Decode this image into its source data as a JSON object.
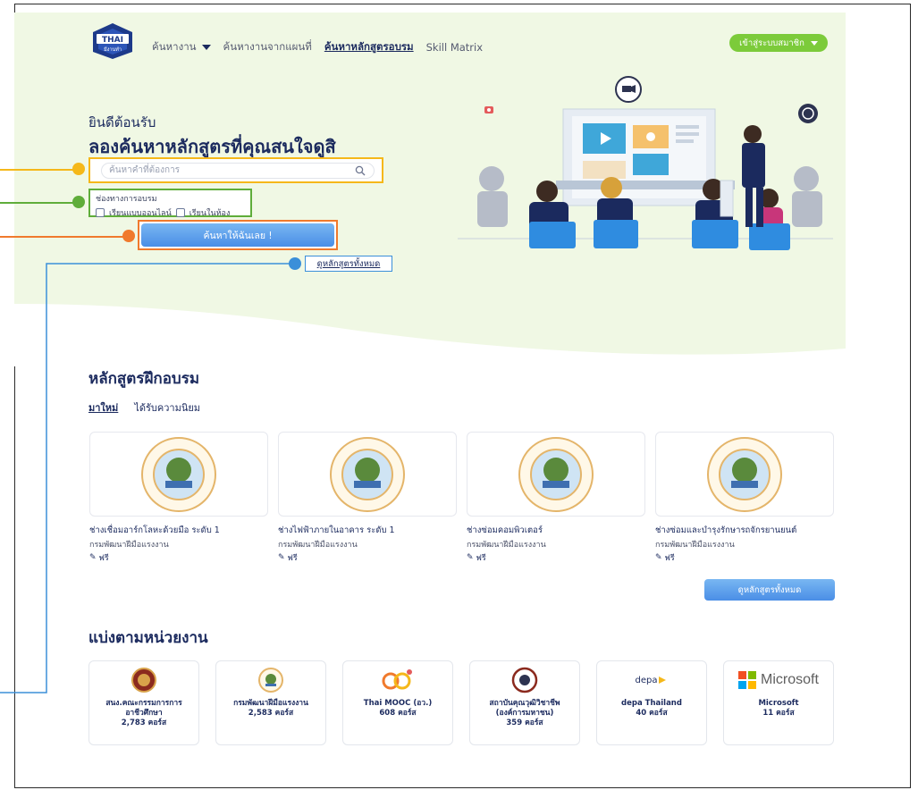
{
  "header": {
    "logo_text": "THAI",
    "logo_sub": "มีงานทำ",
    "nav": [
      {
        "label": "ค้นหางาน",
        "has_caret": true,
        "active": false
      },
      {
        "label": "ค้นหางานจากแผนที่",
        "has_caret": false,
        "active": false
      },
      {
        "label": "ค้นหาหลักสูตรอบรม",
        "has_caret": false,
        "active": true
      },
      {
        "label": "Skill Matrix",
        "has_caret": false,
        "active": false
      }
    ],
    "member_button": "เข้าสู่ระบบสมาชิก"
  },
  "hero": {
    "welcome": "ยินดีต้อนรับ",
    "headline": "ลองค้นหาหลักสูตรที่คุณสนใจดูสิ",
    "search_placeholder": "ค้นหาคำที่ต้องการ",
    "mode_label": "ช่องทางการอบรม",
    "mode_online": "เรียนแบบออนไลน์",
    "mode_classroom": "เรียนในห้อง",
    "search_button": "ค้นหาให้ฉันเลย !",
    "all_courses_link": "ดูหลักสูตรทั้งหมด"
  },
  "courses": {
    "title": "หลักสูตรฝึกอบรม",
    "tabs": [
      "มาใหม่",
      "ได้รับความนิยม"
    ],
    "items": [
      {
        "title": "ช่างเชื่อมอาร์กโลหะด้วยมือ ระดับ 1",
        "org": "กรมพัฒนาฝีมือแรงงาน",
        "price": "ฟรี"
      },
      {
        "title": "ช่างไฟฟ้าภายในอาคาร ระดับ 1",
        "org": "กรมพัฒนาฝีมือแรงงาน",
        "price": "ฟรี"
      },
      {
        "title": "ช่างซ่อมคอมพิวเตอร์",
        "org": "กรมพัฒนาฝีมือแรงงาน",
        "price": "ฟรี"
      },
      {
        "title": "ช่างซ่อมและบำรุงรักษารถจักรยานยนต์",
        "org": "กรมพัฒนาฝีมือแรงงาน",
        "price": "ฟรี"
      }
    ],
    "view_all_button": "ดูหลักสูตรทั้งหมด"
  },
  "agencies": {
    "title": "แบ่งตามหน่วยงาน",
    "items": [
      {
        "name_line1": "สนง.คณะกรรมการการ",
        "name_line2": "อาชีวศึกษา",
        "count": "2,783 คอร์ส"
      },
      {
        "name_line1": "กรมพัฒนาฝีมือแรงงาน",
        "name_line2": "",
        "count": "2,583 คอร์ส"
      },
      {
        "name_line1": "Thai MOOC (อว.)",
        "name_line2": "",
        "count": "608 คอร์ส"
      },
      {
        "name_line1": "สถาบันคุณวุฒิวิชาชีพ",
        "name_line2": "(องค์การมหาชน)",
        "count": "359 คอร์ส"
      },
      {
        "name_line1": "depa Thailand",
        "name_line2": "",
        "count": "40 คอร์ส"
      },
      {
        "name_line1": "Microsoft",
        "name_line2": "",
        "count": "11 คอร์ส"
      }
    ],
    "depa_logo_text": "depa",
    "microsoft_logo_text": "Microsoft"
  },
  "colors": {
    "navy": "#1b2a5e",
    "green": "#7ccb3a",
    "blue": "#4a8ee6",
    "yellow": "#f5b81a",
    "orange": "#f07a2d",
    "annotation_green": "#5fad3a",
    "annotation_blue": "#3b8fd9"
  }
}
